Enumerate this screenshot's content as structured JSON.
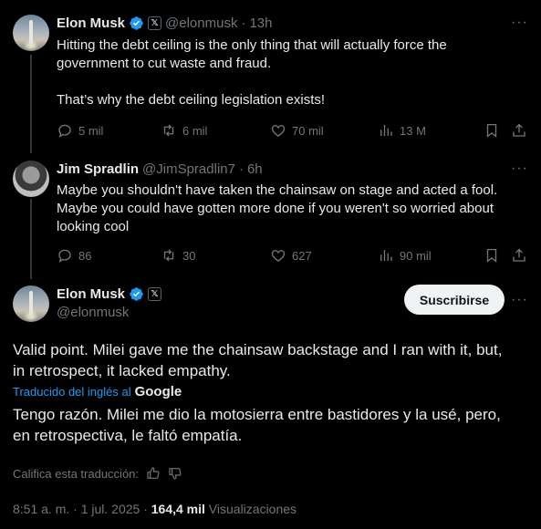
{
  "tweets": [
    {
      "name": "Elon Musk",
      "handle": "@elonmusk",
      "time": "13h",
      "lines": [
        "Hitting the debt ceiling is the only thing that will actually force the",
        "government to cut waste and fraud.",
        "",
        "That’s why the debt ceiling legislation exists!"
      ],
      "replies": "5 mil",
      "reposts": "6 mil",
      "likes": "70 mil",
      "views": "13 M"
    },
    {
      "name": "Jim Spradlin",
      "handle": "@JimSpradlin7",
      "time": "6h",
      "lines": [
        "Maybe you shouldn't have taken the chainsaw on stage and acted a fool.",
        "Maybe you could have gotten more done if you weren't so worried about",
        "looking cool"
      ],
      "replies": "86",
      "reposts": "30",
      "likes": "627",
      "views": "90 mil"
    }
  ],
  "main": {
    "name": "Elon Musk",
    "handle": "@elonmusk",
    "subscribe_label": "Suscribirse",
    "text_lines": [
      "Valid point. Milei gave me the chainsaw backstage and I ran with it, but,",
      "in retrospect, it lacked empathy."
    ],
    "translated_label": "Traducido del inglés al",
    "google_label": "Google",
    "translation_lines": [
      "Tengo razón. Milei me dio la motosierra entre bastidores y la usé, pero,",
      "en retrospectiva, le faltó empatía."
    ],
    "rate_label": "Califica esta traducción:",
    "timestamp": "8:51 a. m. · 1 jul. 2025 ·",
    "views_count": "164,4 mil",
    "views_label": "Visualizaciones"
  },
  "colors": {
    "accent": "#1d9bf0",
    "muted": "#71767b",
    "text": "#e7e9ea",
    "background": "#000000"
  },
  "more_glyph": "···",
  "separator": "·"
}
